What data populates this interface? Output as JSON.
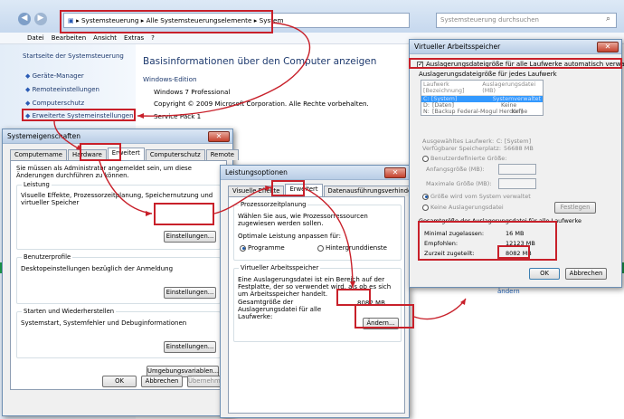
{
  "explorer": {
    "breadcrumb": [
      "Systemsteuerung",
      "Alle Systemsteuerungselemente",
      "System"
    ],
    "search_placeholder": "Systemsteuerung durchsuchen",
    "menu": [
      "Datei",
      "Bearbeiten",
      "Ansicht",
      "Extras",
      "?"
    ],
    "sidebar_title": "Startseite der Systemsteuerung",
    "sidebar_links": [
      "Geräte-Manager",
      "Remoteeinstellungen",
      "Computerschutz",
      "Erweiterte Systemeinstellungen"
    ],
    "heading": "Basisinformationen über den Computer anzeigen",
    "edition_label": "Windows-Edition",
    "edition": "Windows 7 Professional",
    "copyright": "Copyright © 2009 Microsoft Corporation. Alle Rechte vorbehalten.",
    "service_pack": "Service Pack 1",
    "change_link": "ändern"
  },
  "sysprops": {
    "title": "Systemeigenschaften",
    "tabs": [
      "Computername",
      "Hardware",
      "Erweitert",
      "Computerschutz",
      "Remote"
    ],
    "admin_note": "Sie müssen als Administrator angemeldet sein, um diese Änderungen durchführen zu können.",
    "perf_title": "Leistung",
    "perf_text": "Visuelle Effekte, Prozessorzeitplanung, Speichernutzung und virtueller Speicher",
    "settings_btn": "Einstellungen...",
    "profiles_title": "Benutzerprofile",
    "profiles_text": "Desktopeinstellungen bezüglich der Anmeldung",
    "startup_title": "Starten und Wiederherstellen",
    "startup_text": "Systemstart, Systemfehler und Debuginformationen",
    "env_btn": "Umgebungsvariablen...",
    "ok": "OK",
    "cancel": "Abbrechen",
    "apply": "Übernehmen"
  },
  "perfopts": {
    "title": "Leistungsoptionen",
    "tabs": [
      "Visuelle Effekte",
      "Erweitert",
      "Datenausführungsverhinderung"
    ],
    "sched_title": "Prozessorzeitplanung",
    "sched_text": "Wählen Sie aus, wie Prozessorressourcen zugewiesen werden sollen.",
    "optimal_label": "Optimale Leistung anpassen für:",
    "opt_programs": "Programme",
    "opt_services": "Hintergrunddienste",
    "vm_title": "Virtueller Arbeitsspeicher",
    "vm_text": "Eine Auslagerungsdatei ist ein Bereich auf der Festplatte, der so verwendet wird, als ob es sich um Arbeitsspeicher handelt.",
    "vm_total_label": "Gesamtgröße der Auslagerungsdatei für alle Laufwerke:",
    "vm_total": "8082 MB",
    "change_btn": "Ändern..."
  },
  "vmem": {
    "title": "Virtueller Arbeitsspeicher",
    "auto_label": "Auslagerungsdateigröße für alle Laufwerke automatisch verwalten",
    "per_drive_label": "Auslagerungsdateigröße für jedes Laufwerk",
    "col_drive": "Laufwerk [Bezeichnung]",
    "col_file": "Auslagerungsdatei (MB)",
    "drives": [
      {
        "drive": "C:",
        "label": "[System]",
        "size": "Systemverwaltet"
      },
      {
        "drive": "D:",
        "label": "[Daten]",
        "size": "Keine"
      },
      {
        "drive": "N:",
        "label": "[Backup Federal-Mogul Herdorf]",
        "size": "Keine"
      }
    ],
    "sel_drive_label": "Ausgewähltes Laufwerk:",
    "sel_drive": "C:  [System]",
    "free_label": "Verfügbarer Speicherplatz:",
    "free": "56688 MB",
    "custom_label": "Benutzerdefinierte Größe:",
    "initial_label": "Anfangsgröße (MB):",
    "max_label": "Maximale Größe (MB):",
    "sys_managed": "Größe wird vom System verwaltet",
    "none_label": "Keine Auslagerungsdatei",
    "set_btn": "Festlegen",
    "total_title": "Gesamtgröße der Auslagerungsdatei für alle Laufwerke",
    "min_label": "Minimal zugelassen:",
    "min_val": "16 MB",
    "rec_label": "Empfohlen:",
    "rec_val": "12123 MB",
    "cur_label": "Zurzeit zugeteilt:",
    "cur_val": "8082 MB",
    "ok": "OK",
    "cancel": "Abbrechen"
  },
  "colors": {
    "highlight": "#c8202a",
    "select": "#3399ff",
    "link": "#1e5fb4",
    "explorer_bg": "#dce8f4"
  }
}
